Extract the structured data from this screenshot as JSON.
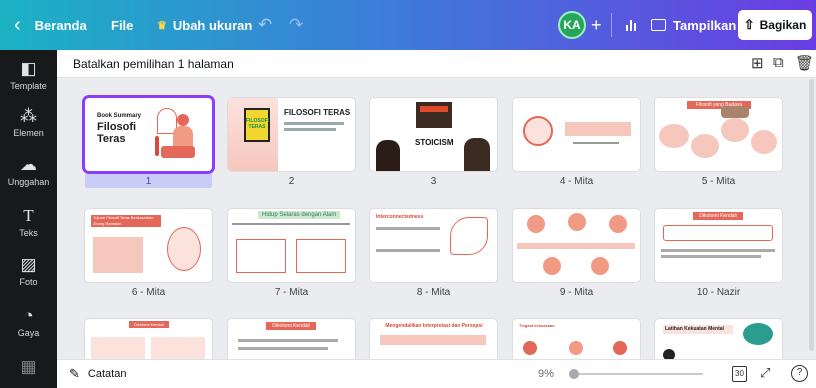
{
  "topbar": {
    "back_label": "Beranda",
    "file_label": "File",
    "resize_label": "Ubah ukuran",
    "avatar_initials": "KA",
    "present_label": "Tampilkan",
    "share_label": "Bagikan"
  },
  "sidebar": {
    "items": [
      {
        "label": "Template",
        "icon": "template-icon"
      },
      {
        "label": "Elemen",
        "icon": "elements-icon"
      },
      {
        "label": "Unggahan",
        "icon": "upload-icon"
      },
      {
        "label": "Teks",
        "icon": "text-icon"
      },
      {
        "label": "Foto",
        "icon": "photo-icon"
      },
      {
        "label": "Gaya",
        "icon": "styles-icon"
      }
    ]
  },
  "toolbar": {
    "deselect_label": "Batalkan pemilihan 1 halaman"
  },
  "pages": [
    {
      "label": "1",
      "title": "Book Summary",
      "title2": "Filosofi",
      "title3": "Teras"
    },
    {
      "label": "2",
      "title": "FILOSOFI TERAS",
      "book": "FILOSOFI TERAS"
    },
    {
      "label": "3",
      "title": "STOICISM"
    },
    {
      "label": "4 - Mita"
    },
    {
      "label": "5 - Mita",
      "title": "Filosofi yang Budaya"
    },
    {
      "label": "6 - Mita",
      "title": "Tujuan Filosofi Teras Berdasarkan Zhong Ramalan"
    },
    {
      "label": "7 - Mita",
      "title": "Hidup Selaras dengan Alam"
    },
    {
      "label": "8 - Mita",
      "title": "Interconnectedness"
    },
    {
      "label": "9 - Mita"
    },
    {
      "label": "10 - Nazir",
      "title": "Dikotomi Kendali"
    },
    {
      "label": "",
      "title": "Dikotomi Kendali"
    },
    {
      "label": "",
      "title": "Dikotomi Kendali"
    },
    {
      "label": "",
      "title": "Mengendalikan Interpretasi dan Persepsi"
    },
    {
      "label": "",
      "title": "Tingkat kekuasaan"
    },
    {
      "label": "",
      "title": "Latihan Kekuatan Mental"
    }
  ],
  "bottombar": {
    "notes_label": "Catatan",
    "zoom": "9%",
    "zoom_value": 0.02,
    "page_count": "30"
  },
  "colors": {
    "selection": "#8b3dff",
    "accent_peach": "#f6c7bd",
    "accent_red": "#d84a3c",
    "dark": "#18191b"
  }
}
